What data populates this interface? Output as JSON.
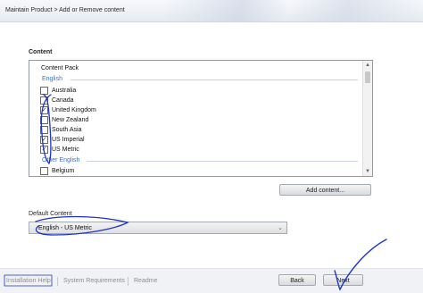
{
  "header": {
    "breadcrumb": "Maintain Product > Add or Remove content"
  },
  "content_section": {
    "label": "Content",
    "list_header": "Content Pack",
    "groups": [
      {
        "label": "English",
        "items": [
          {
            "label": "Australia",
            "checked": false
          },
          {
            "label": "Canada",
            "checked": false
          },
          {
            "label": "United Kingdom",
            "checked": true
          },
          {
            "label": "New Zealand",
            "checked": false
          },
          {
            "label": "South Asia",
            "checked": false
          },
          {
            "label": "US Imperial",
            "checked": true
          },
          {
            "label": "US Metric",
            "checked": true
          }
        ]
      },
      {
        "label": "Other English",
        "items": [
          {
            "label": "Belgium",
            "checked": false
          }
        ]
      }
    ],
    "check_glyph": "✓",
    "scroll_up_glyph": "▲",
    "scroll_down_glyph": "▼",
    "add_content_label": "Add content..."
  },
  "default_content": {
    "label": "Default Content",
    "selected": "English - US Metric",
    "chevron_glyph": "⌄"
  },
  "footer": {
    "links": [
      "Installation Help",
      "System Requirements",
      "Readme"
    ],
    "back_label": "Back",
    "next_label": "Next"
  },
  "colors": {
    "group_label": "#3d6fd0",
    "annotation_ink": "#1d35c2"
  },
  "icons": {
    "checkbox_checked": "check-icon",
    "scroll_up": "chevron-up-icon",
    "scroll_down": "chevron-down-icon",
    "combo": "chevron-down-icon"
  }
}
